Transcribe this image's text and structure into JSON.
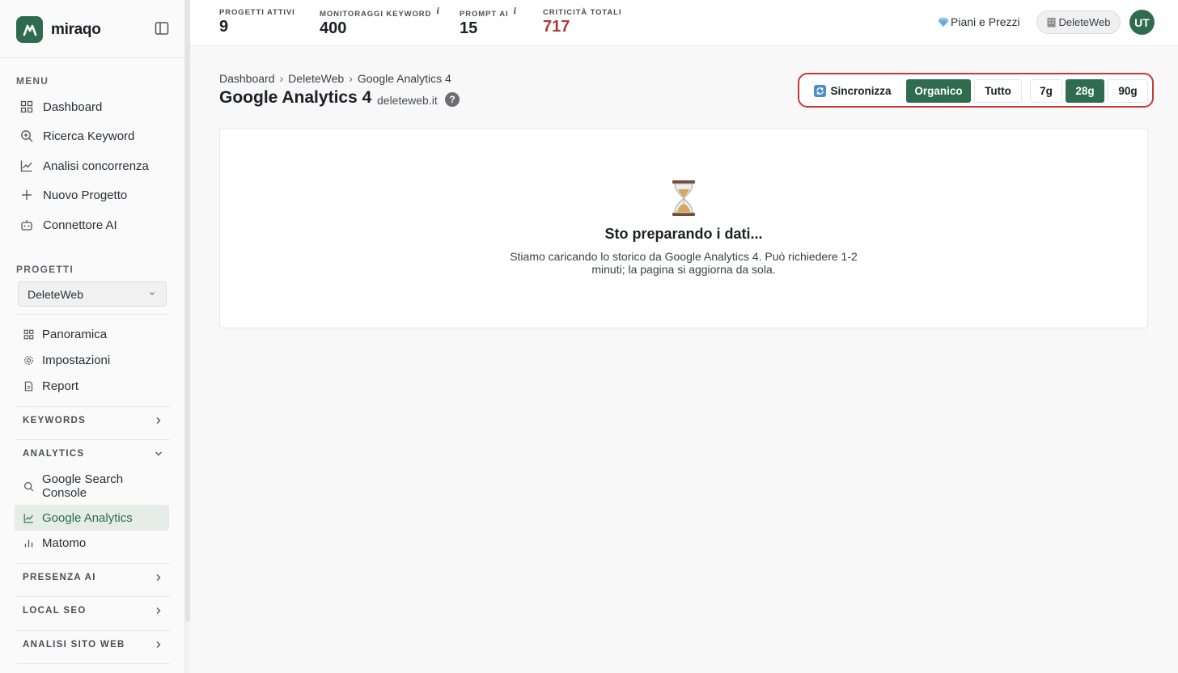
{
  "sidebar": {
    "logo_text": "miraqo",
    "menu_label": "MENU",
    "menu_items": [
      {
        "label": "Dashboard",
        "icon": "grid-icon"
      },
      {
        "label": "Ricerca Keyword",
        "icon": "search-plus-icon"
      },
      {
        "label": "Analisi concorrenza",
        "icon": "line-chart-icon"
      },
      {
        "label": "Nuovo Progetto",
        "icon": "plus-icon"
      },
      {
        "label": "Connettore AI",
        "icon": "robot-icon"
      }
    ],
    "projects_label": "PROGETTI",
    "project_selected": "DeleteWeb",
    "project_items": [
      {
        "label": "Panoramica",
        "icon": "grid-icon"
      },
      {
        "label": "Impostazioni",
        "icon": "gear-icon"
      },
      {
        "label": "Report",
        "icon": "document-icon"
      }
    ],
    "groups": {
      "keywords": "KEYWORDS",
      "analytics": "ANALYTICS",
      "presenza_ai": "PRESENZA AI",
      "local_seo": "LOCAL SEO",
      "analisi_sito": "ANALISI SITO WEB"
    },
    "analytics_items": [
      {
        "label": "Google Search Console",
        "icon": "search-icon"
      },
      {
        "label": "Google Analytics",
        "icon": "line-chart-icon",
        "active": true
      },
      {
        "label": "Matomo",
        "icon": "bar-chart-icon"
      }
    ]
  },
  "topbar": {
    "stats": [
      {
        "label": "PROGETTI ATTIVI",
        "value": "9",
        "info": false
      },
      {
        "label": "MONITORAGGI KEYWORD",
        "value": "400",
        "info": true
      },
      {
        "label": "PROMPT AI",
        "value": "15",
        "info": true
      },
      {
        "label": "CRITICITÀ TOTALI",
        "value": "717",
        "info": false
      }
    ],
    "info_glyph": "i",
    "plans_label": "Piani e Prezzi",
    "account_label": "DeleteWeb",
    "avatar_initials": "UT"
  },
  "breadcrumb": [
    "Dashboard",
    "DeleteWeb",
    "Google Analytics 4"
  ],
  "breadcrumb_sep": "›",
  "page": {
    "title": "Google Analytics 4",
    "domain": "deleteweb.it",
    "help": "?"
  },
  "controls": {
    "sync_label": "Sincronizza",
    "traffic_options": [
      "Organico",
      "Tutto"
    ],
    "traffic_selected": "Organico",
    "ranges": [
      "7g",
      "28g",
      "90g"
    ],
    "range_selected": "28g"
  },
  "loading": {
    "title": "Sto preparando i dati...",
    "description": "Stiamo caricando lo storico da Google Analytics 4. Può richiedere 1-2 minuti; la pagina si aggiorna da sola."
  },
  "colors": {
    "brand": "#2e6b4f",
    "critical": "#b03a3a",
    "highlight_border": "#c43a3a"
  }
}
